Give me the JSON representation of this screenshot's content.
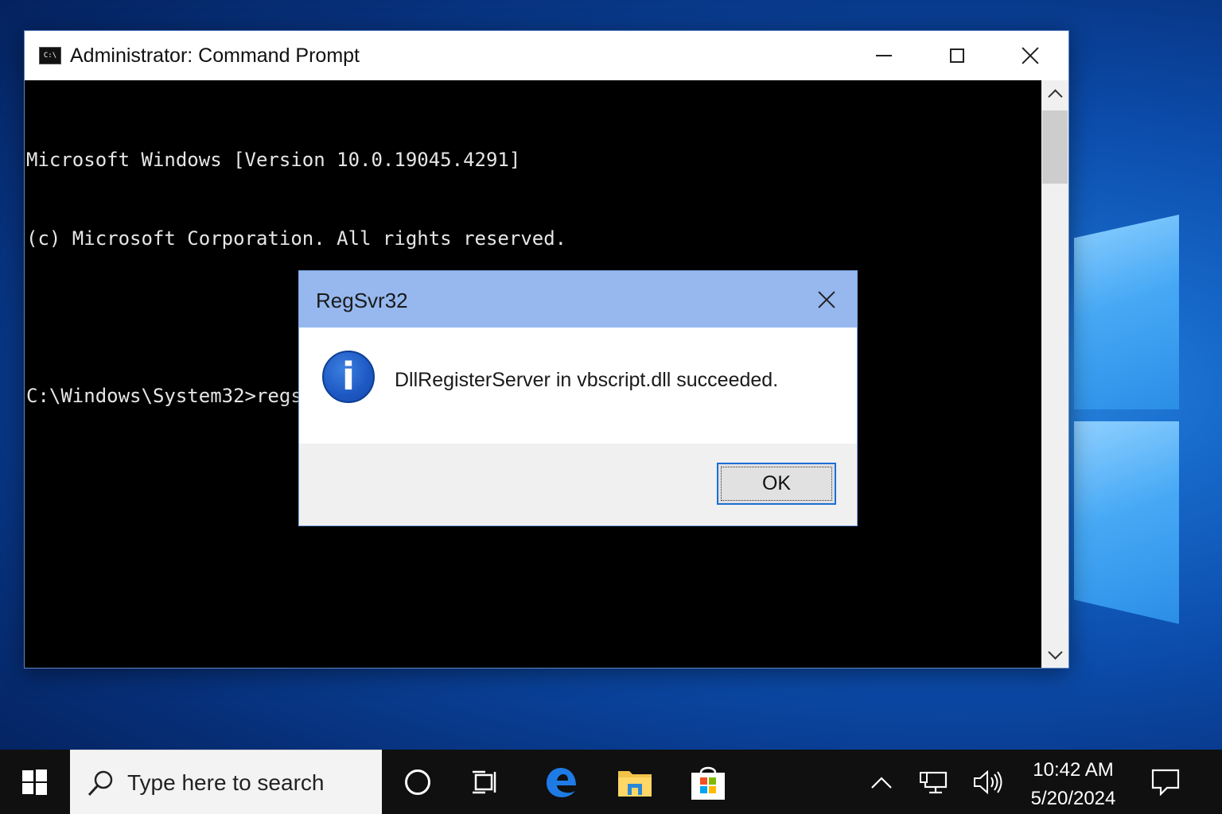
{
  "cmd_window": {
    "title": "Administrator: Command Prompt",
    "icon_text": "C:\\",
    "lines": [
      "Microsoft Windows [Version 10.0.19045.4291]",
      "(c) Microsoft Corporation. All rights reserved.",
      "",
      "C:\\Windows\\System32>regsvr32 vbscript.dll"
    ]
  },
  "dialog": {
    "title": "RegSvr32",
    "message": "DllRegisterServer in vbscript.dll succeeded.",
    "ok_label": "OK",
    "icon_glyph": "i"
  },
  "taskbar": {
    "search_placeholder": "Type here to search",
    "time": "10:42 AM",
    "date": "5/20/2024"
  },
  "colors": {
    "dialog_title_bar": "#96b8ef",
    "info_icon_blue": "#1d58c2",
    "ok_border": "#1a6fd8",
    "taskbar": "#101010"
  }
}
